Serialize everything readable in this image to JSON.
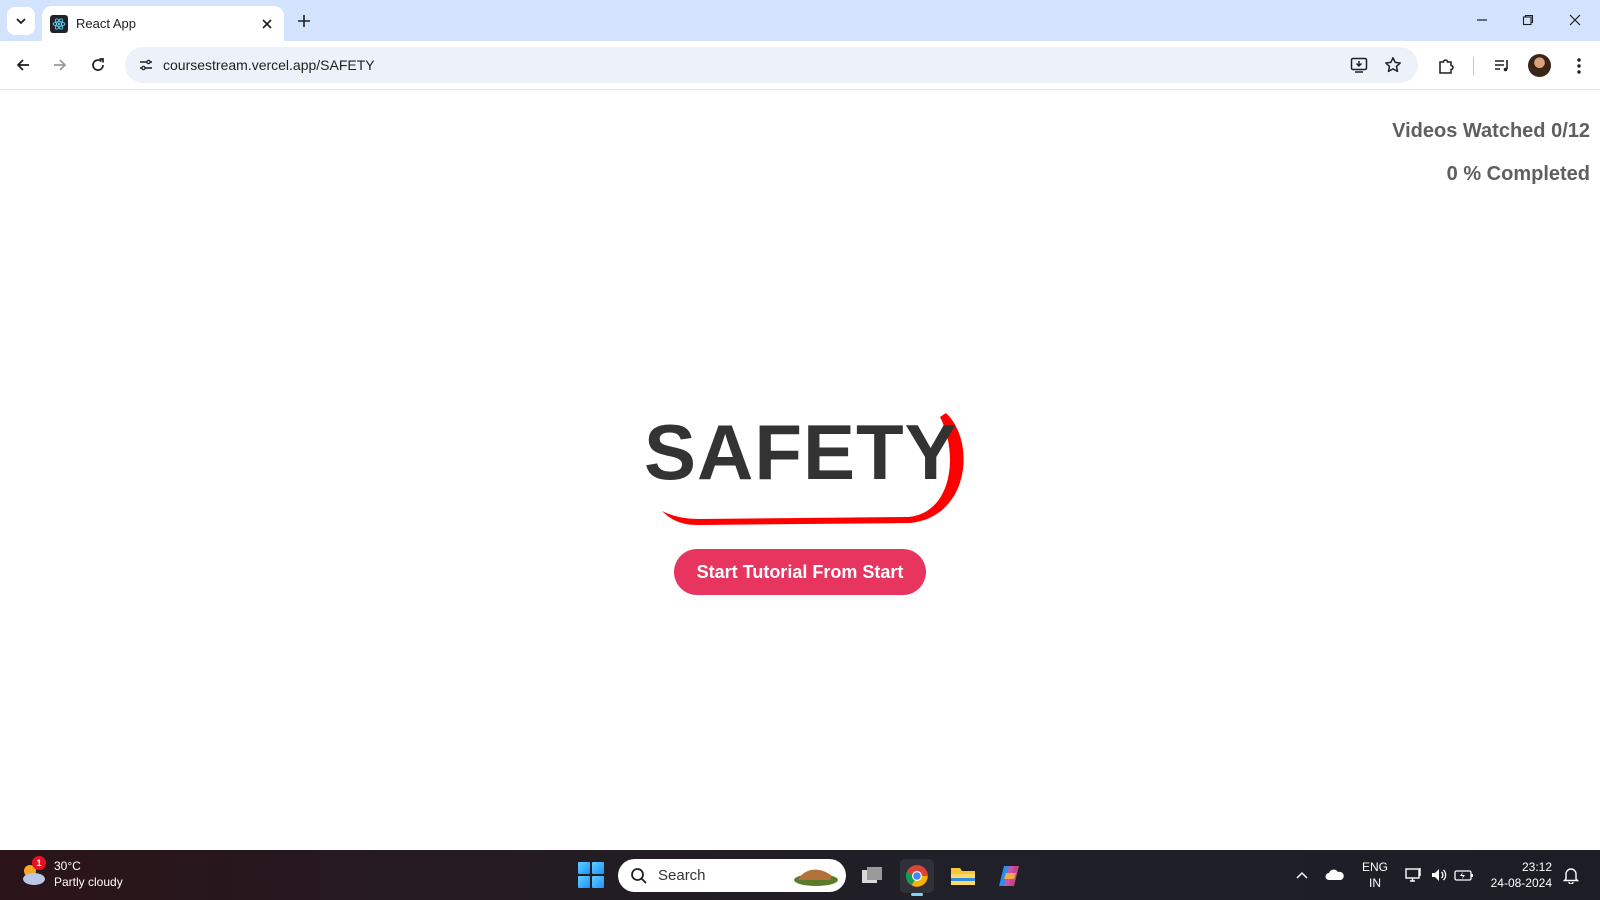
{
  "browser": {
    "tab": {
      "title": "React App",
      "favicon": "react-logo-icon"
    },
    "address_bar": {
      "url": "coursestream.vercel.app/SAFETY"
    },
    "icons": [
      "tab-search-icon",
      "close-icon",
      "plus-icon",
      "minimize-icon",
      "restore-icon",
      "close-window-icon",
      "back-arrow-icon",
      "forward-arrow-icon",
      "reload-icon",
      "site-info-icon",
      "install-app-icon",
      "bookmark-star-icon",
      "extensions-puzzle-icon",
      "media-controls-icon",
      "profile-avatar",
      "menu-dots-icon"
    ]
  },
  "page": {
    "progress": {
      "videos_watched": "Videos Watched 0/12",
      "completed": "0 % Completed"
    },
    "hero": {
      "title": "SAFETY",
      "accent_color": "#ff0000"
    },
    "cta": {
      "label": "Start Tutorial From Start",
      "color": "#e8355f"
    }
  },
  "taskbar": {
    "weather": {
      "badge": "1",
      "temperature": "30°C",
      "condition": "Partly cloudy"
    },
    "search_placeholder": "Search",
    "apps": [
      "windows-start-icon",
      "task-view-icon",
      "chrome-icon",
      "file-explorer-icon",
      "copilot-icon"
    ],
    "tray": {
      "language_line1": "ENG",
      "language_line2": "IN",
      "time": "23:12",
      "date": "24-08-2024"
    }
  }
}
